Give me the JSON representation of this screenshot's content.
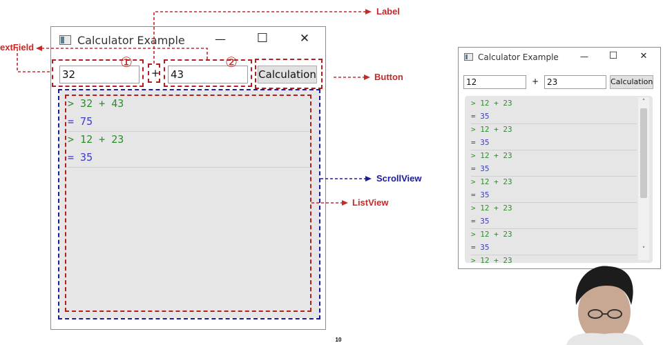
{
  "annotations": {
    "label": "Label",
    "textfield": "extField",
    "button": "Button",
    "scrollview": "ScrollView",
    "listview": "ListView"
  },
  "main_window": {
    "title": "Calculator Example",
    "minimize": "—",
    "maximize": "☐",
    "close": "✕",
    "field1_value": "32",
    "operator_label": "+",
    "field2_value": "43",
    "button_label": "Calculation",
    "handwritten_marks": [
      "①",
      "②"
    ],
    "rows": [
      {
        "input": "> 32 + 43",
        "result": "= 75"
      },
      {
        "input": "> 12 + 23",
        "result": "= 35"
      }
    ]
  },
  "small_window": {
    "title": "Calculator Example",
    "minimize": "—",
    "maximize": "☐",
    "close": "✕",
    "field1_value": "12",
    "operator_label": "+",
    "field2_value": "23",
    "button_label": "Calculation",
    "rows": [
      {
        "input": "> 12 + 23",
        "result": "= 35"
      },
      {
        "input": "> 12 + 23",
        "result": "= 35"
      },
      {
        "input": "> 12 + 23",
        "result": "= 35"
      },
      {
        "input": "> 12 + 23",
        "result": "= 35"
      },
      {
        "input": "> 12 + 23",
        "result": "= 35"
      },
      {
        "input": "> 12 + 23",
        "result": "= 35"
      },
      {
        "input": "> 12 + 23",
        "result": ""
      }
    ],
    "scroll_up": "˄",
    "scroll_down": "˅"
  },
  "page_number": "10",
  "colors": {
    "annotation_red": "#c62828",
    "annotation_blue": "#1a1a9a",
    "input_green": "#2e8b2e",
    "result_blue": "#3a3ad0"
  }
}
